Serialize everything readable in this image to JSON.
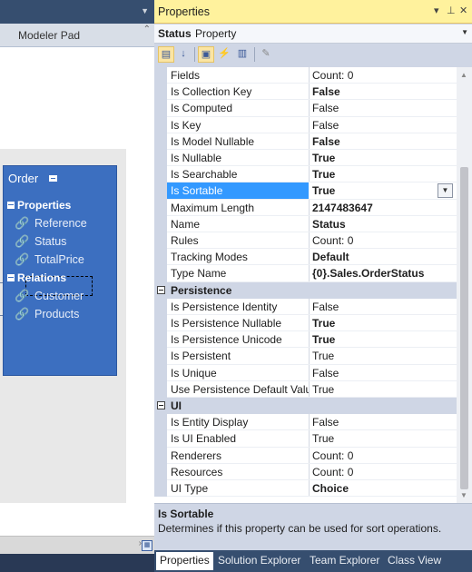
{
  "left_pane": {
    "tab_label": "Modeler Pad",
    "entity": {
      "title": "Order",
      "sections": [
        {
          "label": "Properties",
          "items": [
            "Reference",
            "Status",
            "TotalPrice"
          ]
        },
        {
          "label": "Relations",
          "items": [
            "Customer",
            "Products"
          ]
        }
      ]
    }
  },
  "properties_window": {
    "title": "Properties",
    "controls": {
      "dropdown": "▾",
      "pin": "⊥",
      "close": "✕"
    },
    "object": {
      "name": "Status",
      "kind": "Property"
    },
    "rows_top": [
      {
        "name": "Fields",
        "value": "Count: 0",
        "bold": false
      },
      {
        "name": "Is Collection Key",
        "value": "False",
        "bold": true
      },
      {
        "name": "Is Computed",
        "value": "False",
        "bold": false
      },
      {
        "name": "Is Key",
        "value": "False",
        "bold": false
      },
      {
        "name": "Is Model Nullable",
        "value": "False",
        "bold": true
      },
      {
        "name": "Is Nullable",
        "value": "True",
        "bold": true
      },
      {
        "name": "Is Searchable",
        "value": "True",
        "bold": true
      },
      {
        "name": "Is Sortable",
        "value": "True",
        "bold": true,
        "selected": true
      },
      {
        "name": "Maximum Length",
        "value": "2147483647",
        "bold": true
      },
      {
        "name": "Name",
        "value": "Status",
        "bold": true
      },
      {
        "name": "Rules",
        "value": "Count: 0",
        "bold": false
      },
      {
        "name": "Tracking Modes",
        "value": "Default",
        "bold": true
      },
      {
        "name": "Type Name",
        "value": "{0}.Sales.OrderStatus",
        "bold": true
      }
    ],
    "category_persistence": "Persistence",
    "rows_persistence": [
      {
        "name": "Is Persistence Identity",
        "value": "False",
        "bold": false
      },
      {
        "name": "Is Persistence Nullable",
        "value": "True",
        "bold": true
      },
      {
        "name": "Is Persistence Unicode",
        "value": "True",
        "bold": true
      },
      {
        "name": "Is Persistent",
        "value": "True",
        "bold": false
      },
      {
        "name": "Is Unique",
        "value": "False",
        "bold": false
      },
      {
        "name": "Use Persistence Default Value",
        "value": "True",
        "bold": false
      }
    ],
    "category_ui": "UI",
    "rows_ui": [
      {
        "name": "Is Entity Display",
        "value": "False",
        "bold": false
      },
      {
        "name": "Is UI Enabled",
        "value": "True",
        "bold": false
      },
      {
        "name": "Renderers",
        "value": "Count: 0",
        "bold": false
      },
      {
        "name": "Resources",
        "value": "Count: 0",
        "bold": false
      },
      {
        "name": "UI Type",
        "value": "Choice",
        "bold": true
      }
    ],
    "description": {
      "title": "Is Sortable",
      "text": "Determines if this property can be used for sort operations."
    }
  },
  "bottom_tabs": [
    "Properties",
    "Solution Explorer",
    "Team Explorer",
    "Class View"
  ],
  "colors": {
    "accent": "#3399ff",
    "title_bar": "#fff29d",
    "entity": "#3c6fc0",
    "frame": "#293955"
  }
}
